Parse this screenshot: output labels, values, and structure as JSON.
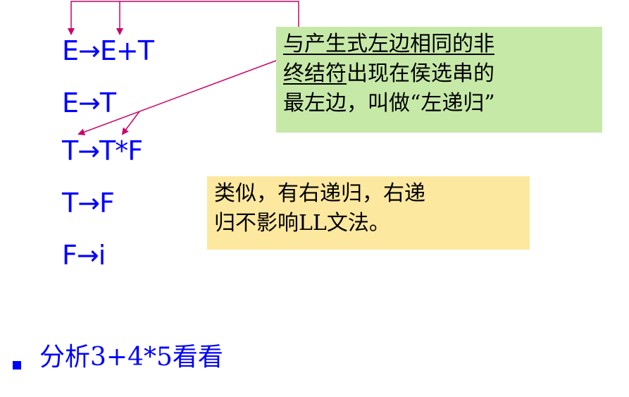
{
  "productions": [
    "E→E+T",
    "E→T",
    "T→T*F",
    "T→F",
    "F→i"
  ],
  "note_left_recursion": {
    "line1": "与产生式左边相同的非",
    "line2_underlined": "终结符",
    "line2_rest": "出现在侯选串的",
    "line3": "最左边，叫做“左递归”"
  },
  "note_right_recursion": {
    "line1": "类似，有右递归，右递",
    "line2": "归不影响LL文法。"
  },
  "bullet": {
    "text": "分析3+4*5看看"
  },
  "colors": {
    "production_text": "#0000ff",
    "arrow": "#cc0066",
    "note_green": "#c6e9a8",
    "note_yellow": "#fde89f"
  }
}
